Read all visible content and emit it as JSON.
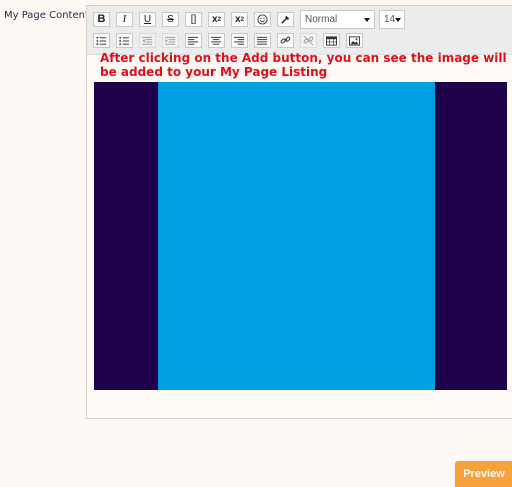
{
  "field": {
    "label": "My Page Content"
  },
  "toolbar": {
    "row1": {
      "bold": "B",
      "italic": "I",
      "underline": "U",
      "strike": "S",
      "code": "[]",
      "superscript": "x",
      "subscript": "x",
      "format_select": "Normal",
      "size_select": "14"
    }
  },
  "content": {
    "text": "After clicking on the Add button, you can see the image will be added to your My Page Listing"
  },
  "image": {
    "outer_color": "#1f004a",
    "inner_color": "#00a0e3"
  },
  "actions": {
    "preview_label": "Preview"
  },
  "colors": {
    "accent": "#f7a13a",
    "text_red": "#e0101a"
  }
}
